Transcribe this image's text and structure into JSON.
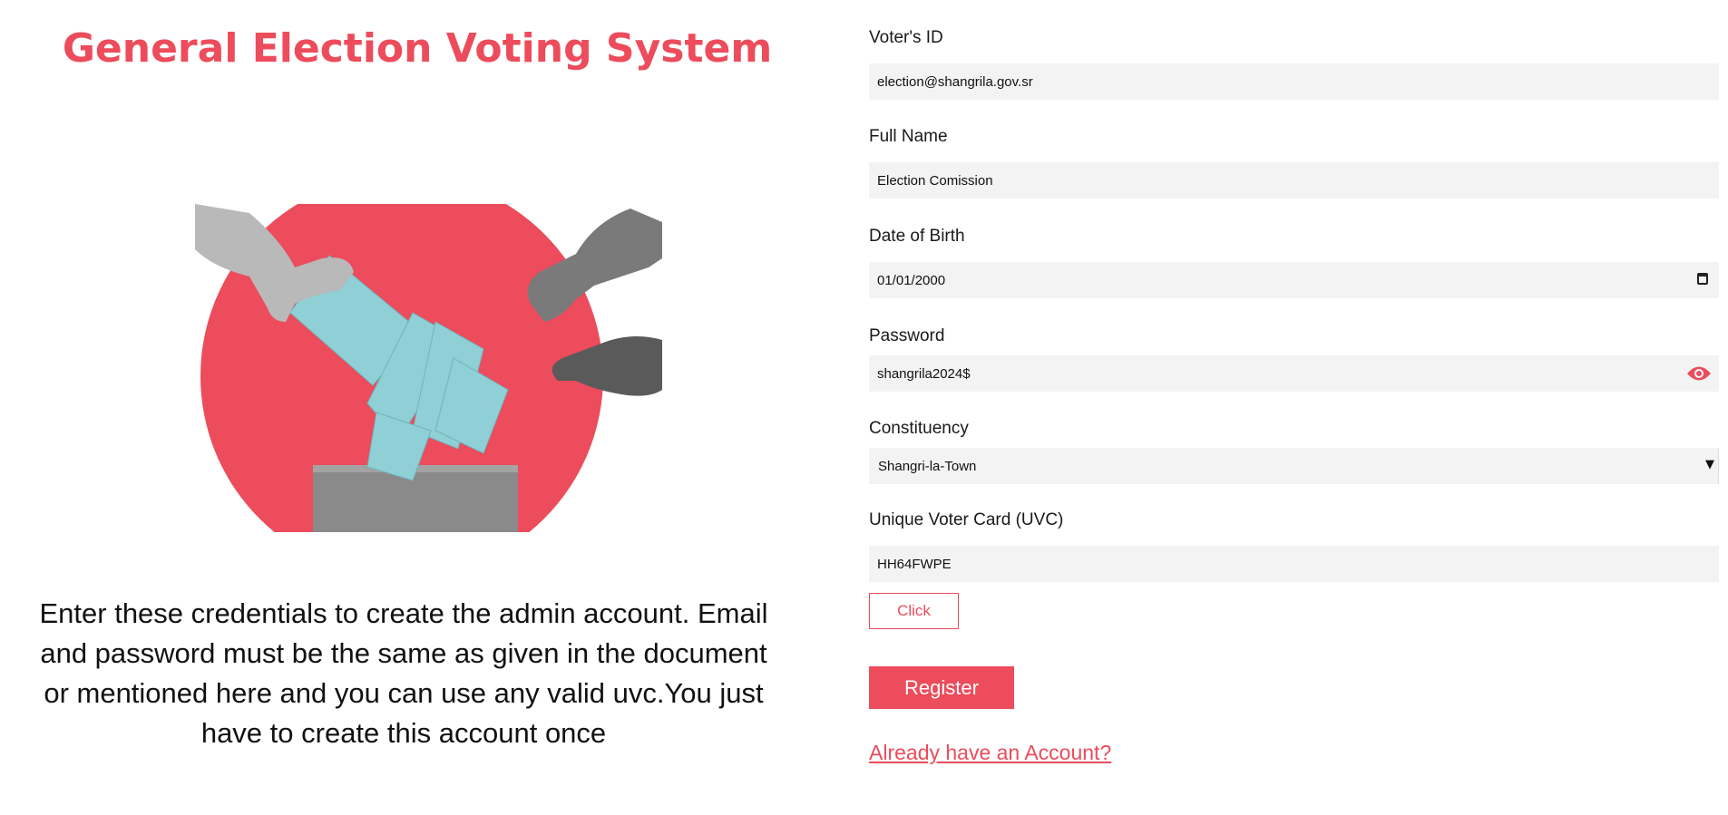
{
  "page": {
    "title": "General Election Voting System",
    "instructions": "Enter these credentials to create the admin account. Email and password must be the same as given in the document or mentioned here and you can use any valid uvc.You just have to create this account once"
  },
  "form": {
    "voter_id": {
      "label": "Voter's ID",
      "value": "election@shangrila.gov.sr"
    },
    "full_name": {
      "label": "Full Name",
      "value": "Election Comission"
    },
    "dob": {
      "label": "Date of Birth",
      "value": "01/01/2000"
    },
    "password": {
      "label": "Password",
      "value": "shangrila2024$"
    },
    "constituency": {
      "label": "Constituency",
      "value": "Shangri-la-Town"
    },
    "uvc": {
      "label": "Unique Voter Card (UVC)",
      "value": "HH64FWPE"
    },
    "click_label": "Click",
    "register_label": "Register",
    "login_link": "Already have an Account?"
  },
  "icons": {
    "password_toggle": "eye-icon",
    "date_picker": "calendar-icon",
    "select": "chevron-down-icon"
  },
  "colors": {
    "accent": "#ec4c5b",
    "field_bg": "#f3f3f3",
    "ballot": "#8fd0d6",
    "ballot_box": "#8a8a8a"
  }
}
